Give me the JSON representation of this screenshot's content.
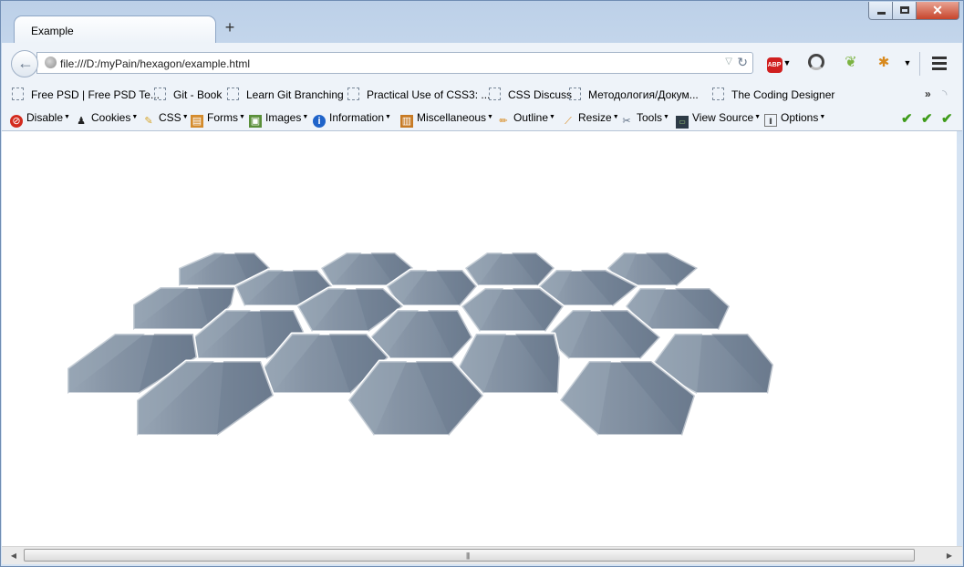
{
  "tab": {
    "title": "Example",
    "new_tab": "+"
  },
  "window_controls": {
    "close": "✕"
  },
  "nav": {
    "url": "file:///D:/myPain/hexagon/example.html",
    "abp_label": "ABP"
  },
  "bookmarks": {
    "items": [
      "Free PSD | Free PSD Te...",
      "Git - Book",
      "Learn Git Branching",
      "Practical Use of CSS3: ...",
      "CSS Discuss",
      "Методология/Докум...",
      "The Coding Designer"
    ],
    "overflow": "»"
  },
  "devtoolbar": {
    "items": [
      {
        "label": "Disable",
        "icon": "disable-icon"
      },
      {
        "label": "Cookies",
        "icon": "cookie-icon"
      },
      {
        "label": "CSS",
        "icon": "css-wand-icon"
      },
      {
        "label": "Forms",
        "icon": "forms-icon"
      },
      {
        "label": "Images",
        "icon": "images-icon"
      },
      {
        "label": "Information",
        "icon": "info-icon"
      },
      {
        "label": "Miscellaneous",
        "icon": "misc-icon"
      },
      {
        "label": "Outline",
        "icon": "pencil-icon"
      },
      {
        "label": "Resize",
        "icon": "ruler-icon"
      },
      {
        "label": "Tools",
        "icon": "tools-icon"
      },
      {
        "label": "View Source",
        "icon": "monitor-icon"
      },
      {
        "label": "Options",
        "icon": "options-icon"
      }
    ],
    "checks": [
      "✔",
      "✔",
      "✔"
    ]
  },
  "content": {
    "hex_colors": {
      "light": "#98a6b5",
      "mid": "#7c8b9d",
      "dark": "#6b7a8d",
      "gap": "#ffffff"
    }
  }
}
